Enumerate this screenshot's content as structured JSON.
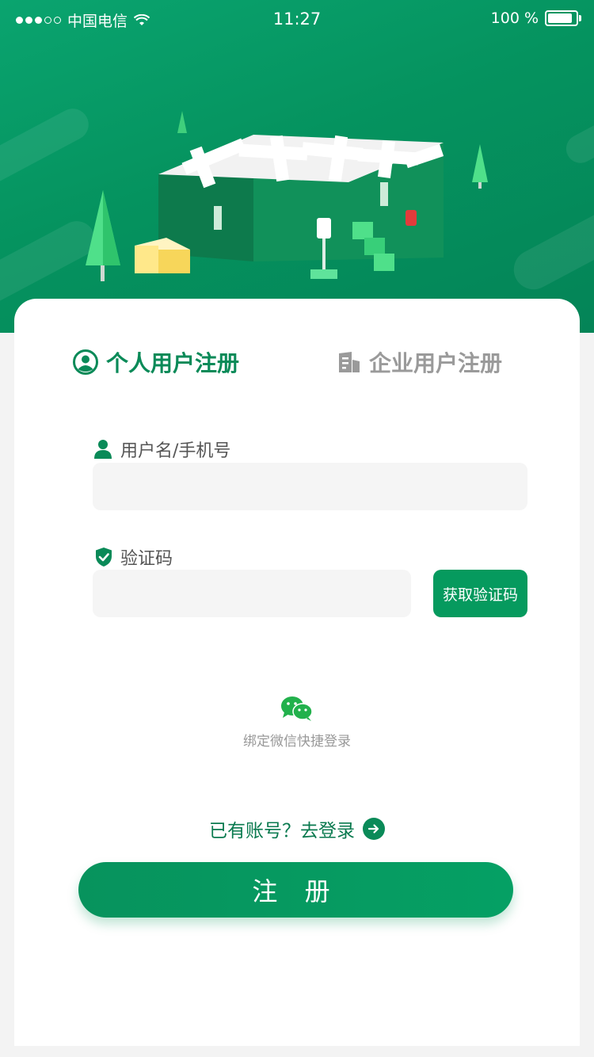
{
  "status_bar": {
    "carrier": "中国电信",
    "time": "11:27",
    "battery": "100 %"
  },
  "tabs": {
    "personal": "个人用户注册",
    "enterprise": "企业用户注册"
  },
  "form": {
    "username_label": "用户名/手机号",
    "username_value": "",
    "code_label": "验证码",
    "code_value": "",
    "get_code_button": "获取验证码"
  },
  "wechat": {
    "label": "绑定微信快捷登录"
  },
  "login_link": "已有账号？去登录",
  "register_button": "注 册",
  "colors": {
    "primary": "#069a5e",
    "header": "#05935f",
    "muted": "#999999"
  }
}
